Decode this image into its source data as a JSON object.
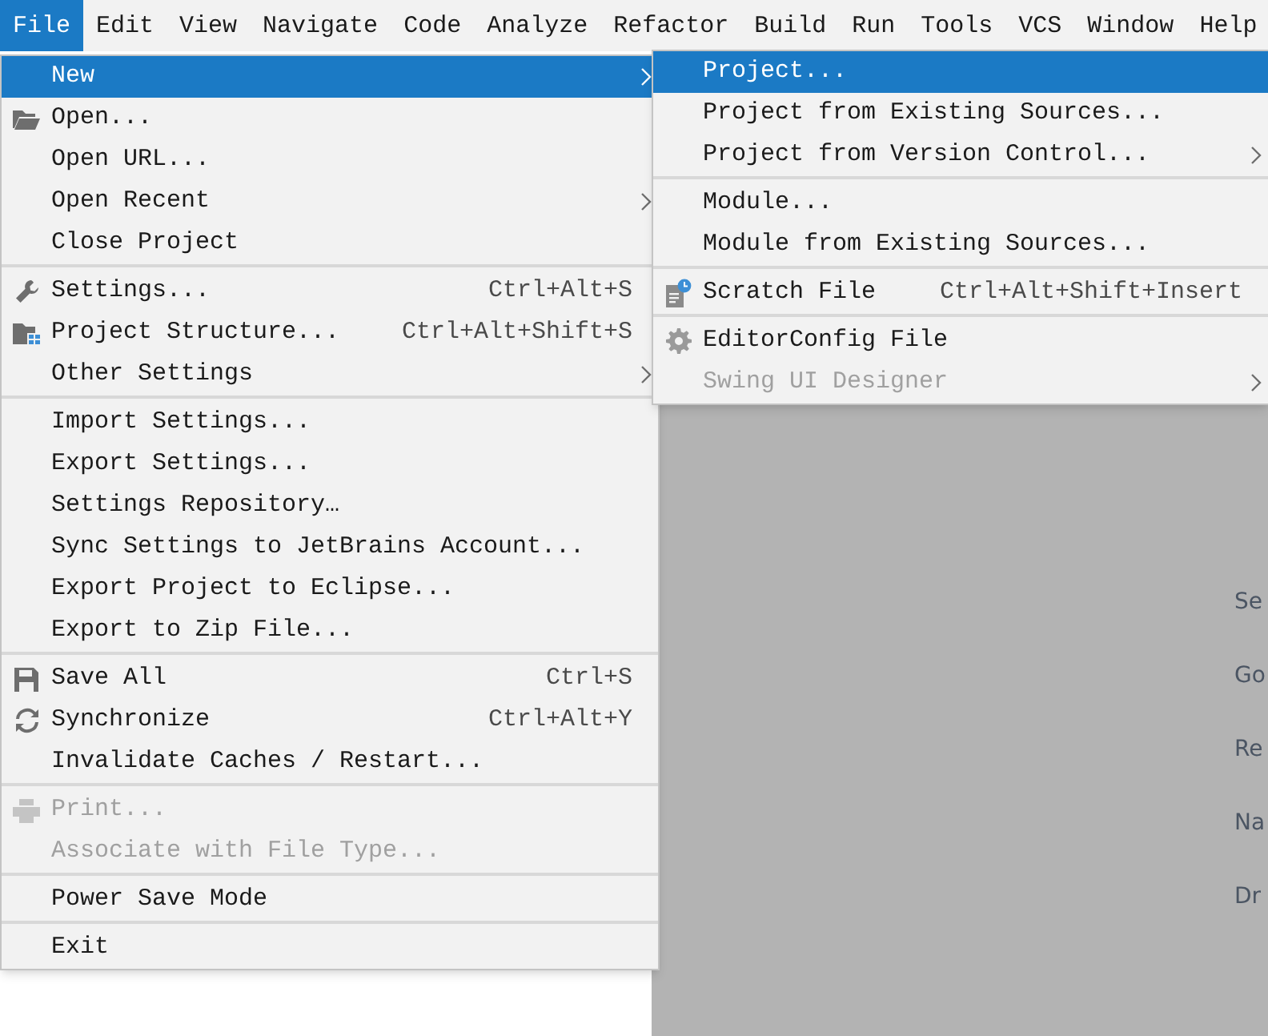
{
  "menubar": [
    {
      "label": "File",
      "selected": true
    },
    {
      "label": "Edit",
      "selected": false
    },
    {
      "label": "View",
      "selected": false
    },
    {
      "label": "Navigate",
      "selected": false
    },
    {
      "label": "Code",
      "selected": false
    },
    {
      "label": "Analyze",
      "selected": false
    },
    {
      "label": "Refactor",
      "selected": false
    },
    {
      "label": "Build",
      "selected": false
    },
    {
      "label": "Run",
      "selected": false
    },
    {
      "label": "Tools",
      "selected": false
    },
    {
      "label": "VCS",
      "selected": false
    },
    {
      "label": "Window",
      "selected": false
    },
    {
      "label": "Help",
      "selected": false
    }
  ],
  "file_menu": {
    "groups": [
      [
        {
          "label": "New",
          "selected": true,
          "disabled": false,
          "submenu": true
        },
        {
          "label": "Open...",
          "selected": false,
          "disabled": false,
          "submenu": false,
          "kind": "folder"
        },
        {
          "label": "Open URL...",
          "selected": false,
          "disabled": false,
          "submenu": false
        },
        {
          "label": "Open Recent",
          "selected": false,
          "disabled": false,
          "submenu": true
        },
        {
          "label": "Close Project",
          "selected": false,
          "disabled": false,
          "submenu": false
        }
      ],
      [
        {
          "label": "Settings...",
          "shortcut": "Ctrl+Alt+S",
          "selected": false,
          "disabled": false,
          "submenu": false,
          "kind": "wrench"
        },
        {
          "label": "Project Structure...",
          "shortcut": "Ctrl+Alt+Shift+S",
          "selected": false,
          "disabled": false,
          "submenu": false,
          "kind": "project"
        },
        {
          "label": "Other Settings",
          "selected": false,
          "disabled": false,
          "submenu": true
        }
      ],
      [
        {
          "label": "Import Settings...",
          "selected": false,
          "disabled": false,
          "submenu": false
        },
        {
          "label": "Export Settings...",
          "selected": false,
          "disabled": false,
          "submenu": false
        },
        {
          "label": "Settings Repository…",
          "selected": false,
          "disabled": false,
          "submenu": false
        },
        {
          "label": "Sync Settings to JetBrains Account...",
          "selected": false,
          "disabled": false,
          "submenu": false
        },
        {
          "label": "Export Project to Eclipse...",
          "selected": false,
          "disabled": false,
          "submenu": false
        },
        {
          "label": "Export to Zip File...",
          "selected": false,
          "disabled": false,
          "submenu": false
        }
      ],
      [
        {
          "label": "Save All",
          "shortcut": "Ctrl+S",
          "selected": false,
          "disabled": false,
          "submenu": false,
          "kind": "save"
        },
        {
          "label": "Synchronize",
          "shortcut": "Ctrl+Alt+Y",
          "selected": false,
          "disabled": false,
          "submenu": false,
          "kind": "sync"
        },
        {
          "label": "Invalidate Caches / Restart...",
          "selected": false,
          "disabled": false,
          "submenu": false
        }
      ],
      [
        {
          "label": "Print...",
          "selected": false,
          "disabled": true,
          "submenu": false,
          "kind": "printer"
        },
        {
          "label": "Associate with File Type...",
          "selected": false,
          "disabled": true,
          "submenu": false
        }
      ],
      [
        {
          "label": "Power Save Mode",
          "selected": false,
          "disabled": false,
          "submenu": false
        }
      ],
      [
        {
          "label": "Exit",
          "selected": false,
          "disabled": false,
          "submenu": false
        }
      ]
    ]
  },
  "new_submenu": {
    "groups": [
      [
        {
          "label": "Project...",
          "selected": true,
          "disabled": false,
          "submenu": false
        },
        {
          "label": "Project from Existing Sources...",
          "selected": false,
          "disabled": false,
          "submenu": false
        },
        {
          "label": "Project from Version Control...",
          "selected": false,
          "disabled": false,
          "submenu": true
        }
      ],
      [
        {
          "label": "Module...",
          "selected": false,
          "disabled": false,
          "submenu": false
        },
        {
          "label": "Module from Existing Sources...",
          "selected": false,
          "disabled": false,
          "submenu": false
        }
      ],
      [
        {
          "label": "Scratch File",
          "shortcut": "Ctrl+Alt+Shift+Insert",
          "selected": false,
          "disabled": false,
          "submenu": false,
          "kind": "scratch"
        }
      ],
      [
        {
          "label": "EditorConfig File",
          "selected": false,
          "disabled": false,
          "submenu": false,
          "kind": "gear"
        },
        {
          "label": "Swing UI Designer",
          "selected": false,
          "disabled": true,
          "submenu": true
        }
      ]
    ]
  },
  "editor_hints": [
    "Se",
    "Go",
    "Re",
    "Na",
    "Dr"
  ]
}
